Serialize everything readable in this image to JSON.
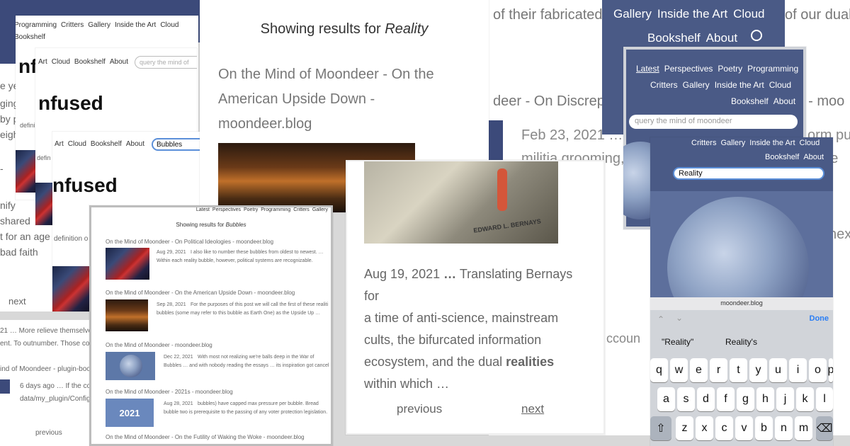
{
  "nav": {
    "full": [
      "Programming",
      "Critters",
      "Gallery",
      "Inside the Art",
      "Cloud",
      "Bookshelf"
    ],
    "row2": [
      "Art",
      "Cloud",
      "Bookshelf",
      "About"
    ],
    "row3": [
      "Art",
      "Cloud",
      "Bookshelf",
      "About"
    ],
    "top_dark_row1": [
      "Gallery",
      "Inside the Art",
      "Cloud"
    ],
    "top_dark_row2": [
      "Bookshelf",
      "About"
    ],
    "mid_row1": [
      "Latest",
      "Perspectives",
      "Poetry",
      "Programming"
    ],
    "mid_row2": [
      "Critters",
      "Gallery",
      "Inside the Art",
      "Cloud"
    ],
    "mid_row3": [
      "Bookshelf",
      "About"
    ],
    "phone_row1": [
      "Critters",
      "Gallery",
      "Inside the Art",
      "Cloud"
    ],
    "phone_row2": [
      "Bookshelf",
      "About"
    ],
    "small_results": [
      "Latest",
      "Perspectives",
      "Poetry",
      "Programming",
      "Critters",
      "Gallery"
    ]
  },
  "search": {
    "placeholder": "query the mind of moondeer",
    "placeholder_short": "query the mind of",
    "value_bubbles": "Bubbles",
    "value_reality": "Reality"
  },
  "brand": {
    "infused": "nfused",
    "infused_short": "nf"
  },
  "left_texts": [
    "e ye",
    "ging vo",
    "by p",
    "eight",
    "-",
    "nify",
    "shared",
    "t for an age",
    "bad faith",
    "defini",
    "defin",
    "definition o"
  ],
  "left_pager": {
    "next": "next",
    "previous": "previous"
  },
  "left_bottom": {
    "line1": "21 … More relieve themselve",
    "line2": "ent. To outnumber. Those co",
    "line3": "ind of Moondeer - plugin-boo",
    "line4": "6 days ago … If the co",
    "line5": "data/my_plugin/Config"
  },
  "results_reality": {
    "header": "Showing results for",
    "term": "Reality",
    "title": "On the Mind of Moondeer - On the American Upside Down - moondeer.blog"
  },
  "results_bubbles": {
    "header": "Showing results for",
    "term": "Bubbles",
    "items": [
      {
        "title": "On the Mind of Moondeer - On Political Ideologies - moondeer.blog",
        "date": "Aug 29, 2021",
        "snippet": "I also like to number these bubbles from oldest to newest. …",
        "snippet2": "Within each reality bubble, however, political systems are recognizable."
      },
      {
        "title": "On the Mind of Moondeer - On the American Upside Down - moondeer.blog",
        "date": "Sep 28, 2021",
        "snippet": "For the purposes of this post we will call the first of these realiti",
        "snippet2": "bubbles (some may refer to this bubble as Earth One) as the Upside Up …"
      },
      {
        "title": "On the Mind of Moondeer - moondeer.blog",
        "date": "Dec 22, 2021",
        "snippet": "With most not realizing we're balls deep in the War of",
        "snippet2": "Bubbles … and with nobody reading the essays … its inspiration got cancel"
      },
      {
        "title": "On the Mind of Moondeer - 2021s - moondeer.blog",
        "date": "Aug 28, 2021",
        "snippet": "bubbles) have capped max pressure per bubble. Bread",
        "snippet2": "bubble two is prerequisite to the passing of any voter protection legislation.",
        "badge": "2021"
      },
      {
        "title": "On the Mind of Moondeer - On the Futility of Waking the Woke - moondeer.blog"
      }
    ]
  },
  "bg_text": {
    "fab": "of their fabricated",
    "disc": "deer - On Discrep",
    "moon_right": ". - moo",
    "date": "Feb 23, 2021 …",
    "militia": "militia grooming,",
    "our": "of our dual",
    "form": "orm pus",
    "e": "o, e",
    "nex": "nex",
    "accoun": "ccoun"
  },
  "bernays": {
    "date": "Aug 19, 2021",
    "ellipsis": "…",
    "text1": "Translating Bernays for",
    "text2": "a time of anti-science, mainstream",
    "text3": "cults, the bifurcated information",
    "text4": "ecosystem, and the dual",
    "bold": "realities",
    "text5": "within which …",
    "previous": "previous",
    "next": "next",
    "book_author": "EDWARD L. BERNAYS"
  },
  "phone": {
    "url": "moondeer.blog",
    "done": "Done",
    "suggestions": [
      "\"Reality\"",
      "Reality's"
    ],
    "row1": [
      "q",
      "w",
      "e",
      "r",
      "t",
      "y",
      "u",
      "i",
      "o",
      "p"
    ],
    "row2": [
      "a",
      "s",
      "d",
      "f",
      "g",
      "h",
      "j",
      "k",
      "l"
    ],
    "row3": [
      "z",
      "x",
      "c",
      "v",
      "b",
      "n",
      "m"
    ]
  }
}
